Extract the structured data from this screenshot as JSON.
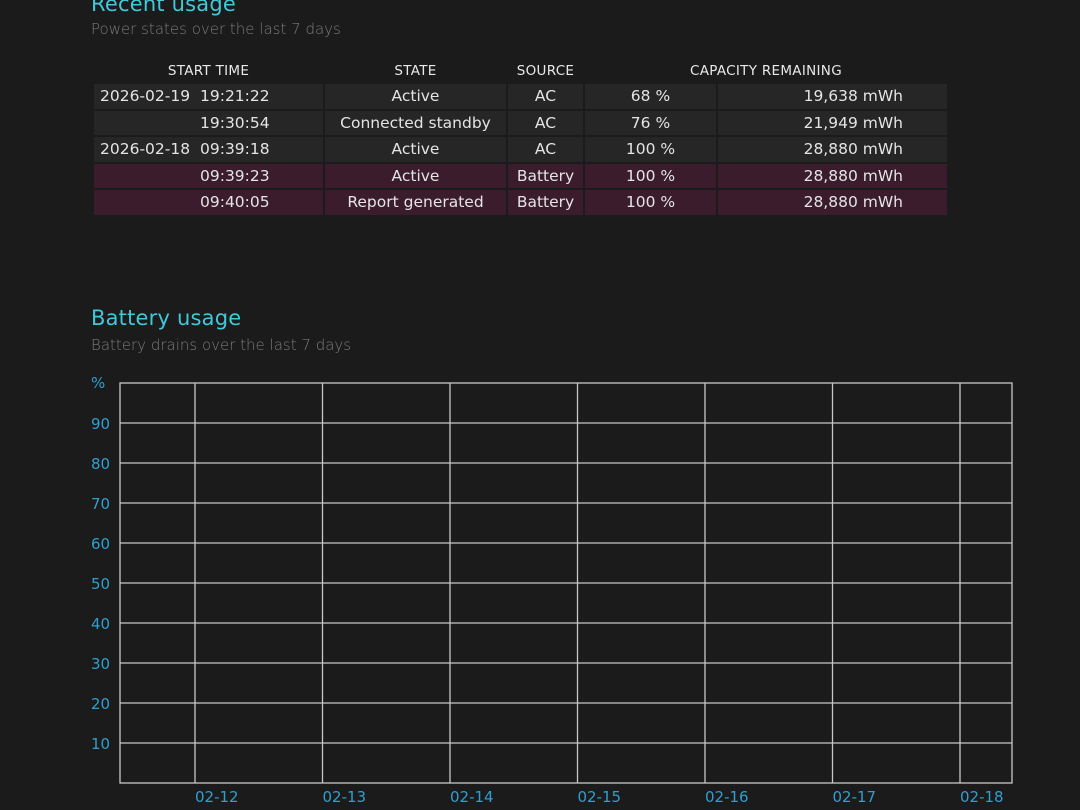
{
  "recent_usage": {
    "title": "Recent usage",
    "subtitle": "Power states over the last 7 days",
    "columns": [
      "START TIME",
      "STATE",
      "SOURCE",
      "CAPACITY REMAINING"
    ],
    "rows": [
      {
        "date": "2026-02-19",
        "time": "19:21:22",
        "state": "Active",
        "source": "AC",
        "percent": "68 %",
        "capacity": "19,638 mWh"
      },
      {
        "date": "",
        "time": "19:30:54",
        "state": "Connected standby",
        "source": "AC",
        "percent": "76 %",
        "capacity": "21,949 mWh"
      },
      {
        "date": "2026-02-18",
        "time": "09:39:18",
        "state": "Active",
        "source": "AC",
        "percent": "100 %",
        "capacity": "28,880 mWh"
      },
      {
        "date": "",
        "time": "09:39:23",
        "state": "Active",
        "source": "Battery",
        "percent": "100 %",
        "capacity": "28,880 mWh"
      },
      {
        "date": "",
        "time": "09:40:05",
        "state": "Report generated",
        "source": "Battery",
        "percent": "100 %",
        "capacity": "28,880 mWh"
      }
    ]
  },
  "battery_usage": {
    "title": "Battery usage",
    "subtitle": "Battery drains over the last 7 days"
  },
  "colors": {
    "accent": "#3fc9d9",
    "axis_label": "#2f9fd1",
    "row_ac": "#262626",
    "row_battery": "#3a1c2c",
    "grid": "#c8c8c8"
  },
  "chart_data": {
    "type": "line",
    "title": "",
    "ylabel": "%",
    "xlabel": "",
    "y_ticks": [
      90,
      80,
      70,
      60,
      50,
      40,
      30,
      20,
      10
    ],
    "x_ticks": [
      "02-12",
      "02-13",
      "02-14",
      "02-15",
      "02-16",
      "02-17",
      "02-18"
    ],
    "ylim": [
      0,
      100
    ],
    "grid": true,
    "series": []
  }
}
